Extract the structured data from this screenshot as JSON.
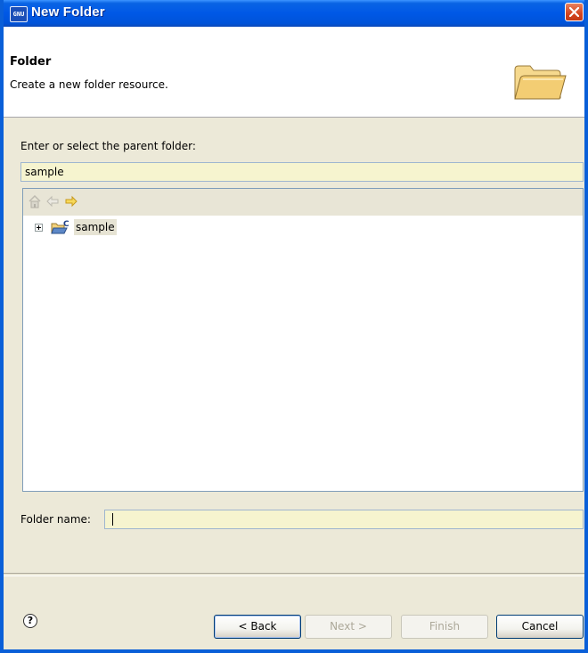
{
  "window": {
    "title": "New Folder",
    "app_icon_text": "GNU"
  },
  "banner": {
    "title": "Folder",
    "description": "Create a new folder resource."
  },
  "parent": {
    "label": "Enter or select the parent folder:",
    "value": "sample"
  },
  "tree": {
    "toolbar": [
      "home-icon",
      "back-arrow-icon",
      "forward-arrow-icon"
    ],
    "items": [
      {
        "label": "sample",
        "icon": "project-folder-icon",
        "expanded": false
      }
    ]
  },
  "folder_name": {
    "label": "Folder name:",
    "value": ""
  },
  "buttons": {
    "back": "< Back",
    "next": "Next >",
    "finish": "Finish",
    "cancel": "Cancel"
  },
  "colors": {
    "titlebar": "#0058e6",
    "input_background": "#f6f4cf",
    "dialog_background": "#ece9d8"
  }
}
